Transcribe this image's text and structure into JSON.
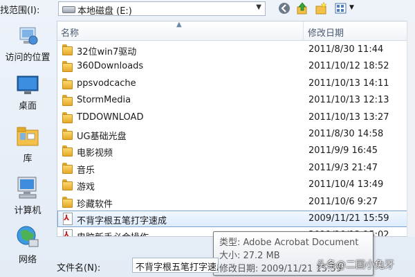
{
  "topbar": {
    "lookin_label": "找范围(I):",
    "location": "本地磁盘 (E:)"
  },
  "places": [
    {
      "label": "访问的位置",
      "icon": "recent-places-icon"
    },
    {
      "label": "桌面",
      "icon": "desktop-icon"
    },
    {
      "label": "库",
      "icon": "libraries-icon"
    },
    {
      "label": "计算机",
      "icon": "computer-icon"
    },
    {
      "label": "网络",
      "icon": "network-icon"
    }
  ],
  "list": {
    "columns": {
      "name": "名称",
      "date": "修改日期"
    },
    "rows": [
      {
        "name": "32位win7驱动",
        "date": "2011/8/30 11:44",
        "type": "folder"
      },
      {
        "name": "360Downloads",
        "date": "2011/10/12 18:52",
        "type": "folder"
      },
      {
        "name": "ppsvodcache",
        "date": "2011/10/13 14:11",
        "type": "folder"
      },
      {
        "name": "StormMedia",
        "date": "2011/10/13 12:13",
        "type": "folder"
      },
      {
        "name": "TDDOWNLOAD",
        "date": "2011/10/13 13:27",
        "type": "folder"
      },
      {
        "name": "UG基础光盘",
        "date": "2011/8/30 14:58",
        "type": "folder"
      },
      {
        "name": "电影视频",
        "date": "2011/9/9 16:45",
        "type": "folder"
      },
      {
        "name": "音乐",
        "date": "2011/9/3 21:47",
        "type": "folder"
      },
      {
        "name": "游戏",
        "date": "2011/10/4 13:49",
        "type": "folder"
      },
      {
        "name": "珍藏软件",
        "date": "2011/10/6 9:27",
        "type": "folder"
      },
      {
        "name": "不背字根五笔打字速成",
        "date": "2009/11/21 15:59",
        "type": "pdf",
        "selected": true
      },
      {
        "name": "电脑新手必会操作",
        "date": "2011/10/12 15:02",
        "type": "pdf"
      }
    ]
  },
  "tooltip": {
    "type_line": "类型: Adobe Acrobat Document",
    "size_line": "大小: 27.2 MB",
    "date_line": "修改日期: 2009/11/21 15:59"
  },
  "filename": {
    "label": "文件名(N):",
    "value": "不背字根五笔打字速成"
  },
  "watermark": "头条@二国小兔牙",
  "colors": {
    "selection": "#dcebfc",
    "selection_border": "#7da2ce",
    "folder": "#f3c14a"
  }
}
